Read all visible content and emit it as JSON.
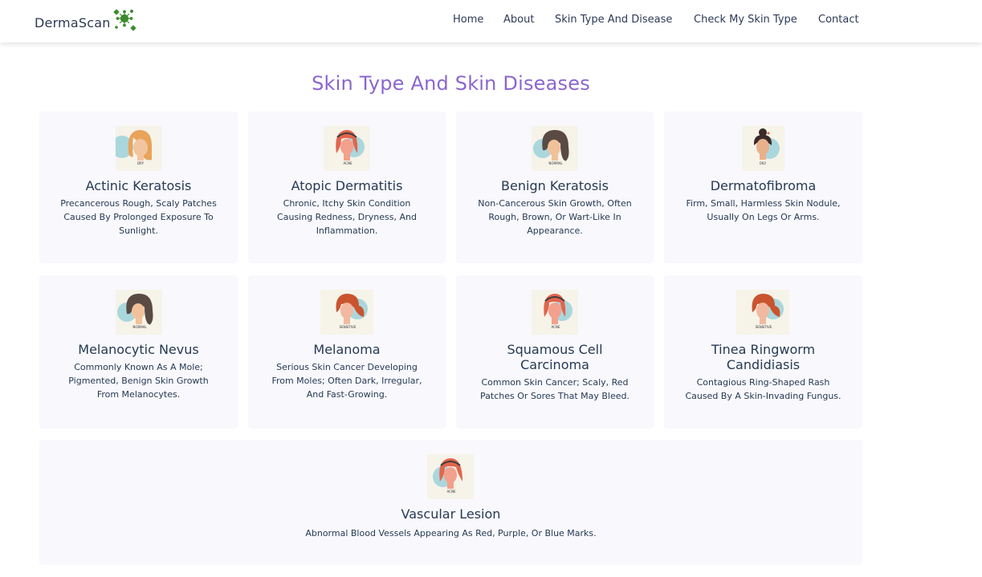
{
  "brand": {
    "name": "DermaScan",
    "logo_icon": "virus-icon",
    "logo_color": "#3c8a2e"
  },
  "nav": {
    "items": [
      {
        "label": "Home"
      },
      {
        "label": "About"
      },
      {
        "label": "Skin Type And Disease"
      },
      {
        "label": "Check My Skin Type"
      },
      {
        "label": "Contact"
      }
    ]
  },
  "page": {
    "title": "Skin Type And Skin Diseases",
    "title_color": "#8a66cf"
  },
  "cards": [
    {
      "title": "Actinic Keratosis",
      "description": "Precancerous Rough, Scaly Patches Caused By Prolonged Exposure To Sunlight.",
      "image_label": "DRY",
      "image_icon": "woman-avatar-icon"
    },
    {
      "title": "Atopic Dermatitis",
      "description": "Chronic, Itchy Skin Condition Causing Redness, Dryness, And Inflammation.",
      "image_label": "ACNE",
      "image_icon": "woman-avatar-icon"
    },
    {
      "title": "Benign Keratosis",
      "description": "Non-Cancerous Skin Growth, Often Rough, Brown, Or Wart-Like In Appearance.",
      "image_label": "NORMAL",
      "image_icon": "woman-avatar-icon"
    },
    {
      "title": "Dermatofibroma",
      "description": "Firm, Small, Harmless Skin Nodule, Usually On Legs Or Arms.",
      "image_label": "OILY",
      "image_icon": "woman-avatar-icon"
    },
    {
      "title": "Melanocytic Nevus",
      "description": "Commonly Known As A Mole; Pigmented, Benign Skin Growth From Melanocytes.",
      "image_label": "NORMAL",
      "image_icon": "woman-avatar-icon"
    },
    {
      "title": "Melanoma",
      "description": "Serious Skin Cancer Developing From Moles; Often Dark, Irregular, And Fast-Growing.",
      "image_label": "SENSITIVE",
      "image_icon": "woman-avatar-icon"
    },
    {
      "title": "Squamous Cell Carcinoma",
      "description": "Common Skin Cancer; Scaly, Red Patches Or Sores That May Bleed.",
      "image_label": "ACNE",
      "image_icon": "woman-avatar-icon"
    },
    {
      "title": "Tinea Ringworm Candidiasis",
      "description": "Contagious Ring-Shaped Rash Caused By A Skin-Invading Fungus.",
      "image_label": "SENSITIVE",
      "image_icon": "woman-avatar-icon"
    },
    {
      "title": "Vascular Lesion",
      "description": "Abnormal Blood Vessels Appearing As Red, Purple, Or Blue Marks.",
      "image_label": "ACNE",
      "image_icon": "woman-avatar-icon"
    }
  ]
}
